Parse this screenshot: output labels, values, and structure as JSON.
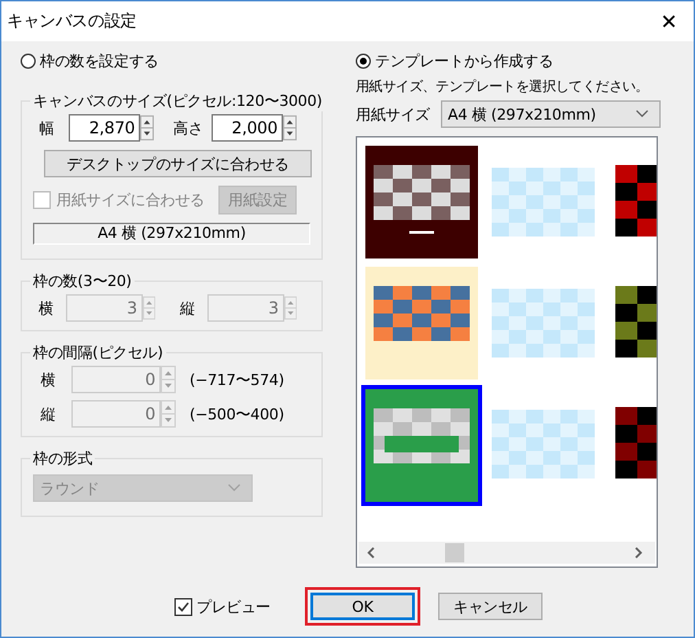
{
  "window": {
    "title": "キャンバスの設定",
    "close": "✕"
  },
  "left": {
    "mode_radio": {
      "label": "枠の数を設定する",
      "selected": false
    },
    "canvas_size": {
      "title": "キャンバスのサイズ(ピクセル:120〜3000)",
      "width": {
        "label": "幅",
        "value": "2,870",
        "disabled": false
      },
      "height": {
        "label": "高さ",
        "value": "2,000",
        "disabled": false
      },
      "fit_desktop_button": "デスクトップのサイズに合わせる",
      "fit_paper": {
        "label": "用紙サイズに合わせる",
        "checked": false,
        "disabled": true
      },
      "paper_settings_button": {
        "label": "用紙設定",
        "disabled": true
      },
      "paper_display": "A4 横 (297x210mm)"
    },
    "frame_count": {
      "title": "枠の数(3〜20)",
      "fields": [
        {
          "label": "横",
          "value": "3",
          "disabled": true
        },
        {
          "label": "縦",
          "value": "3",
          "disabled": true
        }
      ]
    },
    "frame_spacing": {
      "title": "枠の間隔(ピクセル)",
      "rows": [
        {
          "label": "横",
          "value": "0",
          "disabled": true,
          "range": "(−717〜574)"
        },
        {
          "label": "縦",
          "value": "0",
          "disabled": true,
          "range": "(−500〜400)"
        }
      ]
    },
    "frame_style": {
      "title": "枠の形式",
      "value": "ラウンド",
      "disabled": true
    }
  },
  "right": {
    "mode_radio": {
      "label": "テンプレートから作成する",
      "selected": true
    },
    "instruction": "用紙サイズ、テンプレートを選択してください。",
    "paper_size": {
      "label": "用紙サイズ",
      "value": "A4 横 (297x210mm)"
    },
    "templates": [
      {
        "kind": "dark",
        "selected": false
      },
      {
        "kind": "light",
        "selected": false
      },
      {
        "kind": "blocks",
        "color": "#c00000",
        "selected": false
      },
      {
        "kind": "cream",
        "selected": false
      },
      {
        "kind": "light",
        "selected": false
      },
      {
        "kind": "blocks",
        "color": "#6b7a1a",
        "selected": false
      },
      {
        "kind": "green",
        "selected": true
      },
      {
        "kind": "light",
        "selected": false
      },
      {
        "kind": "blocks",
        "color": "#800000",
        "selected": false
      }
    ]
  },
  "footer": {
    "preview": {
      "label": "プレビュー",
      "checked": true
    },
    "ok_button": {
      "label": "OK",
      "highlighted": true
    },
    "cancel_button": "キャンセル"
  }
}
